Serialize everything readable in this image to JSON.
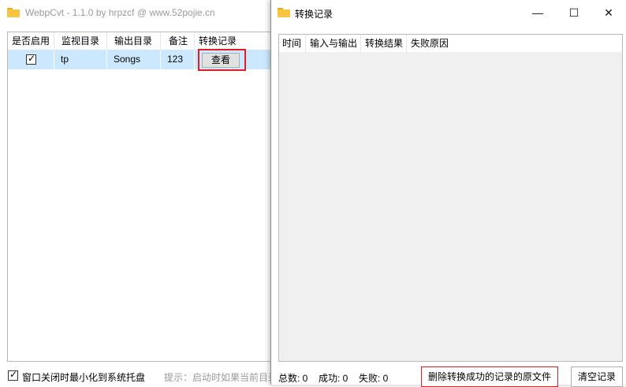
{
  "main": {
    "title": "WebpCvt - 1.1.0 by hrpzcf @ www.52pojie.cn",
    "columns": [
      "是否启用",
      "监视目录",
      "输出目录",
      "备注",
      "转换记录"
    ],
    "rows": [
      {
        "enabled": true,
        "watch_dir": "tp",
        "output_dir": "Songs",
        "note": "123",
        "action": "查看"
      }
    ],
    "footer": {
      "minimize_to_tray_label": "窗口关闭时最小化到系统托盘",
      "minimize_to_tray_checked": true,
      "tip": "提示：启动时如果当前目录"
    }
  },
  "log": {
    "title": "转换记录",
    "columns": [
      "时间",
      "输入与输出",
      "转换结果",
      "失败原因"
    ],
    "stats": {
      "total": "总数: 0",
      "success": "成功: 0",
      "failed": "失败: 0"
    },
    "delete_button": "删除转换成功的记录的原文件",
    "clear_button": "清空记录"
  },
  "window_controls": {
    "minimize": "—",
    "maximize": "☐",
    "close": "✕"
  },
  "colors": {
    "selected_row": "#cce8ff",
    "highlight": "#e31b23",
    "folder": "#f7c542"
  }
}
